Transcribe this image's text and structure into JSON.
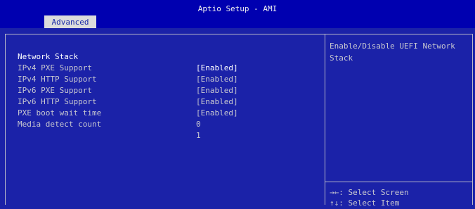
{
  "window": {
    "title": "Aptio Setup - AMI"
  },
  "tabs": [
    {
      "label": "Advanced",
      "active": true
    }
  ],
  "settings": [
    {
      "label": "Network Stack",
      "value": "[Enabled]",
      "selected": true
    },
    {
      "label": "IPv4 PXE Support",
      "value": "[Enabled]",
      "selected": false
    },
    {
      "label": "IPv4 HTTP Support",
      "value": "[Enabled]",
      "selected": false
    },
    {
      "label": "IPv6 PXE Support",
      "value": "[Enabled]",
      "selected": false
    },
    {
      "label": "IPv6 HTTP Support",
      "value": "[Enabled]",
      "selected": false
    },
    {
      "label": "PXE boot wait time",
      "value": "0",
      "selected": false
    },
    {
      "label": "Media detect count",
      "value": "1",
      "selected": false
    }
  ],
  "help": {
    "text": "Enable/Disable UEFI Network Stack"
  },
  "key_help": [
    {
      "keys": "→←",
      "action": ": Select Screen"
    },
    {
      "keys": "↑↓",
      "action": ": Select Item"
    }
  ],
  "colors": {
    "background": "#1b22a8",
    "header": "#0000b0",
    "tab": "#dcdcdc",
    "text": "#c8c8d0",
    "selected_text": "#ffffff"
  }
}
